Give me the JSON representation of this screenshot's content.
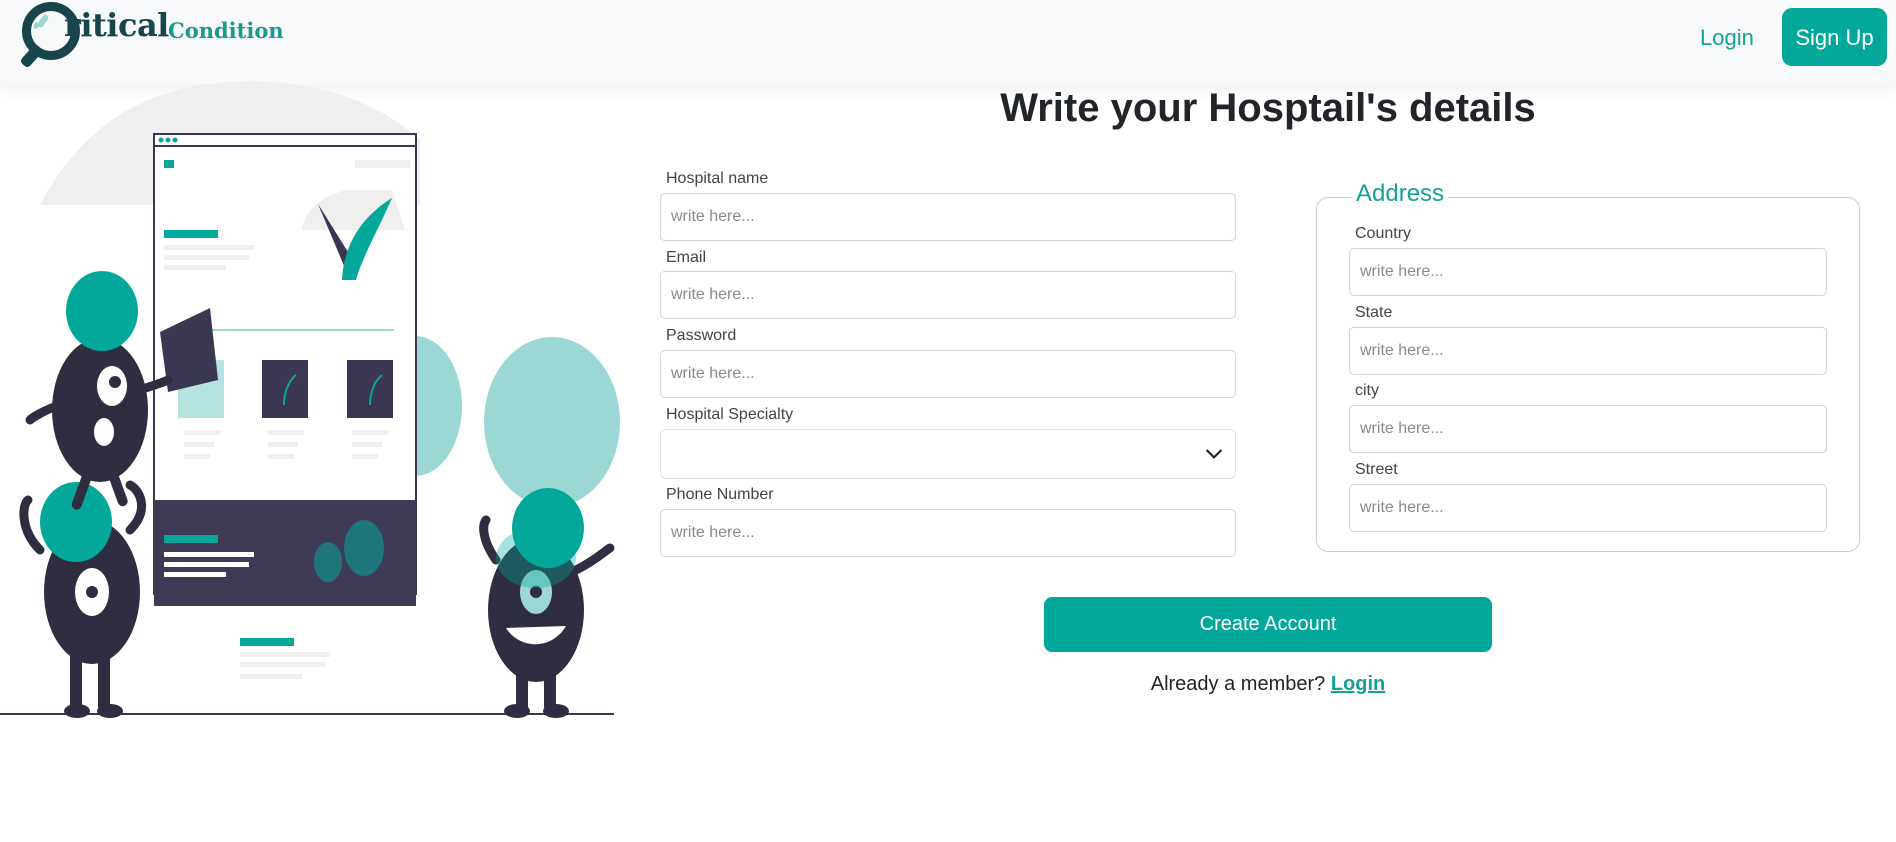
{
  "brand": {
    "logo_primary": "ritical",
    "logo_secondary": "Condition",
    "dark_color": "#18444c",
    "accent_color": "#04a89a"
  },
  "nav": {
    "login_label": "Login",
    "signup_label": "Sign Up"
  },
  "form": {
    "title": "Write your Hosptail's details",
    "placeholder": "write here...",
    "hospital_name_label": "Hospital name",
    "email_label": "Email",
    "password_label": "Password",
    "specialty_label": "Hospital Specialty",
    "specialty_selected": "",
    "phone_label": "Phone Number"
  },
  "address": {
    "legend": "Address",
    "country_label": "Country",
    "state_label": "State",
    "city_label": "city",
    "street_label": "Street"
  },
  "actions": {
    "create_label": "Create Account",
    "member_text": "Already a member?",
    "member_link": "Login"
  },
  "illustration": {
    "icon": "team-building-website-illustration"
  }
}
